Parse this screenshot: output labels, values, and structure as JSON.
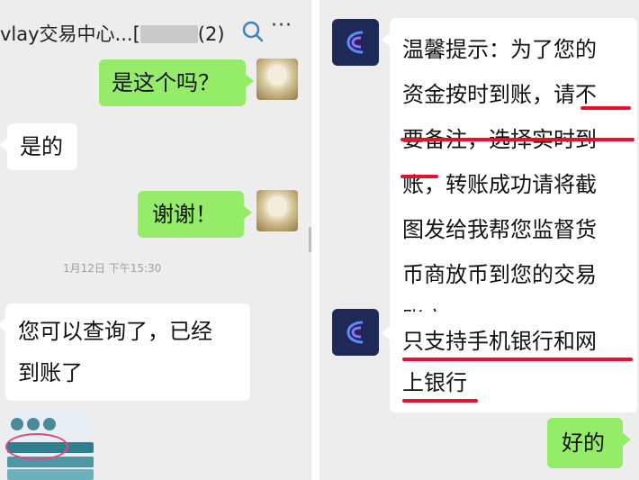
{
  "left_chat": {
    "header": {
      "title": "vlay交易中心...",
      "blurred_name": "[",
      "member_count": "(2)",
      "search_icon": "search-icon",
      "more_label": "···"
    },
    "messages": [
      {
        "side": "right",
        "text": "是这个吗？"
      },
      {
        "side": "left",
        "text": "是的"
      },
      {
        "side": "right",
        "text": "谢谢！"
      },
      {
        "side": "left",
        "text_line1": "您可以查询了，已经",
        "text_line2": "到账了"
      }
    ],
    "timestamp": "1月12日 下午15:30",
    "thumbnail_icon": "screenshot-thumbnail"
  },
  "right_chat": {
    "app_avatar_icon": "app-logo-icon",
    "messages": [
      {
        "side": "left",
        "lines": [
          "温馨提示：为了您的",
          "资金按时到账，请不",
          "要备注，选择实时到",
          "账，转账成功请将截",
          "图发给我帮您监督货",
          "币商放币到您的交易",
          "账户。"
        ]
      },
      {
        "side": "left",
        "lines": [
          "只支持手机银行和网",
          "上银行"
        ]
      },
      {
        "side": "right",
        "text": "好的"
      }
    ],
    "annotation_color": "#e8112d"
  },
  "colors": {
    "chat_bg": "#ededed",
    "sent_bubble": "#95ec69",
    "received_bubble": "#ffffff"
  }
}
